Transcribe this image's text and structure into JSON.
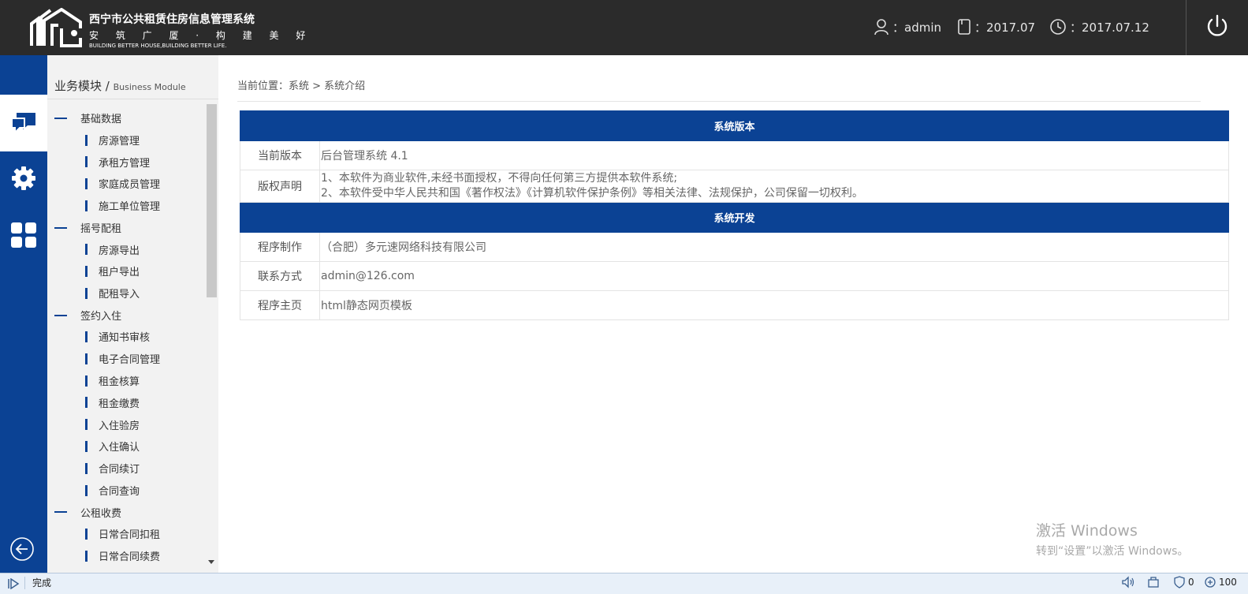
{
  "header": {
    "title": "西宁市公共租赁住房信息管理系统",
    "slogan": "安 筑 广 厦 · 构 建 美 好",
    "slogan_en": "BUILDING BETTER HOUSE,BUILDING BETTER LIFE.",
    "user_label": "：admin",
    "month_label": "：2017.07",
    "date_label": "：2017.07.12"
  },
  "sidebar": {
    "title": "业务模块",
    "title_sep": " / ",
    "title_en": "Business Module",
    "groups": [
      {
        "label": "基础数据",
        "items": [
          "房源管理",
          "承租方管理",
          "家庭成员管理",
          "施工单位管理"
        ]
      },
      {
        "label": "摇号配租",
        "items": [
          "房源导出",
          "租户导出",
          "配租导入"
        ]
      },
      {
        "label": "签约入住",
        "items": [
          "通知书审核",
          "电子合同管理",
          "租金核算",
          "租金缴费",
          "入住验房",
          "入住确认",
          "合同续订",
          "合同查询"
        ]
      },
      {
        "label": "公租收费",
        "items": [
          "日常合同扣租",
          "日常合同续费"
        ]
      }
    ]
  },
  "main": {
    "breadcrumb": "当前位置：系统 > 系统介绍",
    "section1_title": "系统版本",
    "rows1": [
      {
        "label": "当前版本",
        "value": "后台管理系统 4.1"
      }
    ],
    "copyright_label": "版权声明",
    "copyright_line1": "1、本软件为商业软件,未经书面授权，不得向任何第三方提供本软件系统;",
    "copyright_line2": "2、本软件受中华人民共和国《著作权法》《计算机软件保护条例》等相关法律、法规保护，公司保留一切权利。",
    "section2_title": "系统开发",
    "rows2": [
      {
        "label": "程序制作",
        "value": "（合肥）多元速网络科技有限公司"
      },
      {
        "label": "联系方式",
        "value": "admin@126.com"
      },
      {
        "label": "程序主页",
        "value": "html静态网页模板"
      }
    ]
  },
  "watermark": {
    "line1": "激活 Windows",
    "line2": "转到“设置”以激活 Windows。"
  },
  "statusbar": {
    "status": "完成",
    "count": "0",
    "zoom": "100"
  },
  "colors": {
    "topbar": "#2b2b2b",
    "accent": "#0b4294",
    "sidebar_bg": "#f2f2f2"
  }
}
